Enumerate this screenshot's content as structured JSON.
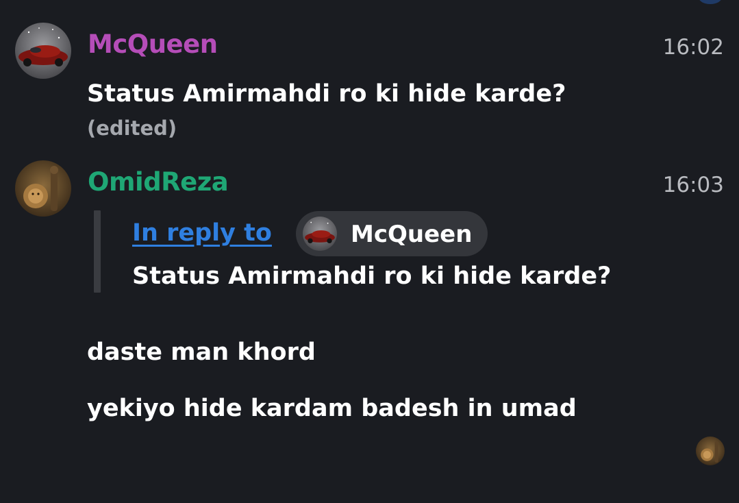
{
  "messages": [
    {
      "sender": "McQueen",
      "sender_color": "#b54db8",
      "time": "16:02",
      "avatar_icon": "red-race-car-avatar",
      "text": "Status Amirmahdi ro ki hide karde?",
      "edited_label": "(edited)"
    },
    {
      "sender": "OmidReza",
      "sender_color": "#1fa775",
      "time": "16:03",
      "avatar_icon": "lion-and-figure-avatar",
      "reply": {
        "link_label": "In reply to",
        "link_color": "#2f7fe0",
        "author": "McQueen",
        "quoted_text": "Status Amirmahdi ro ki hide karde?"
      },
      "lines": [
        "daste man khord",
        "yekiyo hide kardam badesh in umad"
      ]
    }
  ],
  "read_receipt_icon": "lion-and-figure-avatar"
}
